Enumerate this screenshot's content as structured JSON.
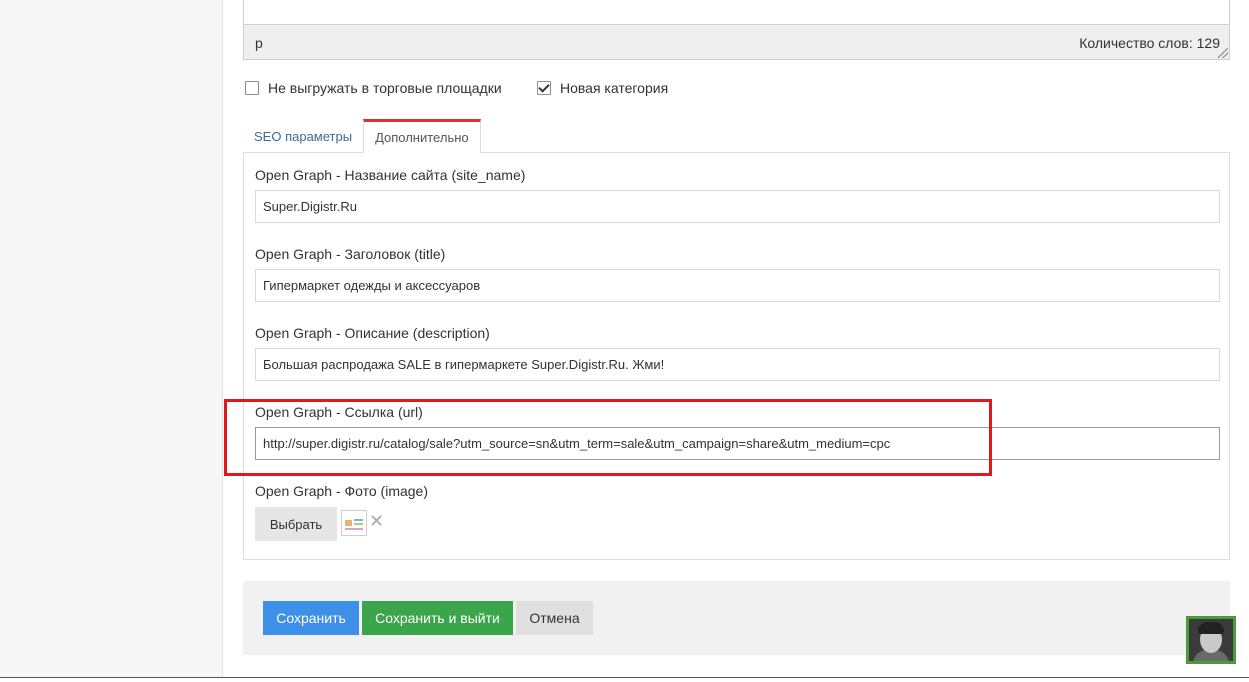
{
  "editor": {
    "path": "p",
    "word_count": "Количество слов: 129"
  },
  "options": {
    "no_export_label": "Не выгружать в торговые площадки",
    "no_export_checked": false,
    "new_category_label": "Новая категория",
    "new_category_checked": true
  },
  "tabs": [
    {
      "label": "SEO параметры",
      "active": false
    },
    {
      "label": "Дополнительно",
      "active": true
    }
  ],
  "fields": {
    "site_name": {
      "label": "Open Graph - Название сайта (site_name)",
      "value": "Super.Digistr.Ru"
    },
    "title": {
      "label": "Open Graph - Заголовок (title)",
      "value": "Гипермаркет одежды и аксессуаров"
    },
    "description": {
      "label": "Open Graph - Описание (description)",
      "value": "Большая распродажа SALE в гипермаркете Super.Digistr.Ru. Жми!"
    },
    "url": {
      "label": "Open Graph - Ссылка (url)",
      "value": "http://super.digistr.ru/catalog/sale?utm_source=sn&utm_term=sale&utm_campaign=share&utm_medium=cpc"
    },
    "image": {
      "label": "Open Graph - Фото (image)",
      "choose_label": "Выбрать",
      "remove_glyph": "✕"
    }
  },
  "actions": {
    "save": "Сохранить",
    "save_exit": "Сохранить и выйти",
    "cancel": "Отмена"
  },
  "colors": {
    "accent_tab": "#dd3333",
    "save": "#3e8fe8",
    "save_exit": "#3aa54a",
    "highlight": "#e3161b"
  }
}
